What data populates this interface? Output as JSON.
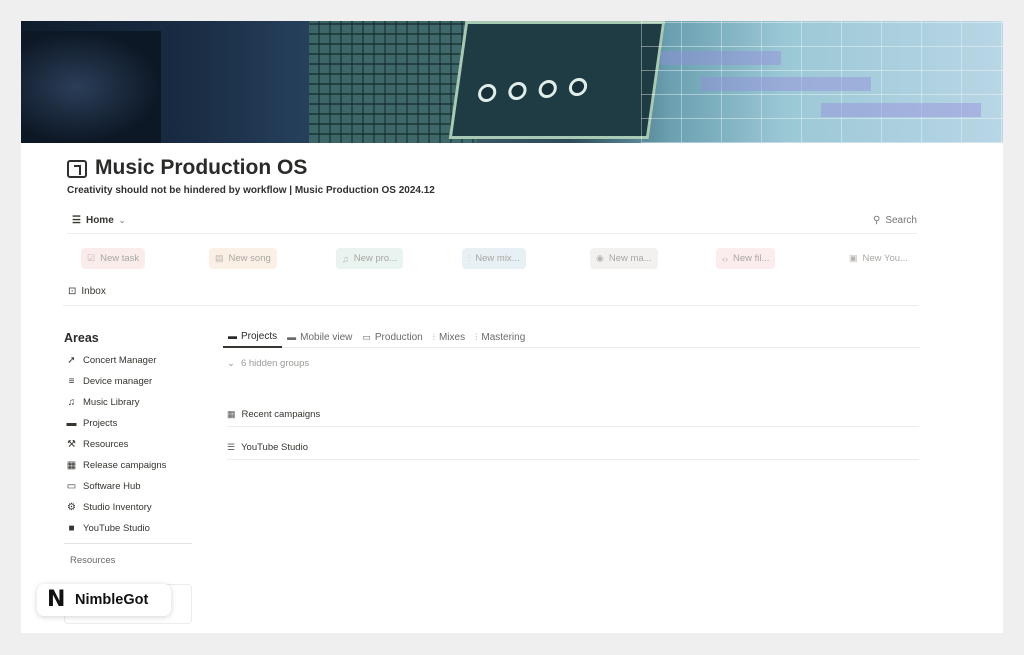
{
  "page": {
    "title": "Music Production OS",
    "subtitle": "Creativity should not be hindered by workflow | Music Production OS 2024.12"
  },
  "viewbar": {
    "view_label": "Home",
    "search_label": "Search"
  },
  "quick_buttons": [
    {
      "label": "New task",
      "icon": "checkbox-icon",
      "tint": "#fbecec"
    },
    {
      "label": "New song",
      "icon": "document-icon",
      "tint": "#fbf0e6"
    },
    {
      "label": "New pro...",
      "icon": "music-icon",
      "tint": "#e9f3f0"
    },
    {
      "label": "New mix...",
      "icon": "sliders-icon",
      "tint": "#e7f1f5"
    },
    {
      "label": "New ma...",
      "icon": "disc-icon",
      "tint": "#f2f1f0"
    },
    {
      "label": "New fil...",
      "icon": "code-icon",
      "tint": "#fbeded"
    },
    {
      "label": "New You...",
      "icon": "video-icon",
      "tint": "#ffffff"
    }
  ],
  "inbox": {
    "label": "Inbox"
  },
  "areas": {
    "title": "Areas",
    "items": [
      {
        "label": "Concert Manager",
        "icon": "megaphone-icon"
      },
      {
        "label": "Device manager",
        "icon": "database-icon"
      },
      {
        "label": "Music Library",
        "icon": "music-icon"
      },
      {
        "label": "Projects",
        "icon": "folder-icon"
      },
      {
        "label": "Resources",
        "icon": "wrench-icon"
      },
      {
        "label": "Release campaigns",
        "icon": "table-icon"
      },
      {
        "label": "Software Hub",
        "icon": "browser-icon"
      },
      {
        "label": "Studio Inventory",
        "icon": "gears-icon"
      },
      {
        "label": "YouTube Studio",
        "icon": "video-icon"
      }
    ],
    "partial_label": "Resources"
  },
  "tabs": [
    {
      "label": "Projects",
      "icon": "folder-icon",
      "active": true
    },
    {
      "label": "Mobile view",
      "icon": "folder-icon",
      "active": false
    },
    {
      "label": "Production",
      "icon": "laptop-icon",
      "active": false
    },
    {
      "label": "Mixes",
      "icon": "sliders-icon",
      "active": false
    },
    {
      "label": "Mastering",
      "icon": "sliders-icon",
      "active": false
    }
  ],
  "groups": {
    "hidden_label": "6 hidden groups",
    "rows": [
      {
        "label": "Recent campaigns",
        "icon": "table-icon"
      },
      {
        "label": "YouTube Studio",
        "icon": "list-icon"
      }
    ]
  },
  "brand": {
    "name": "NimbleGot",
    "logo_letter": "N"
  }
}
